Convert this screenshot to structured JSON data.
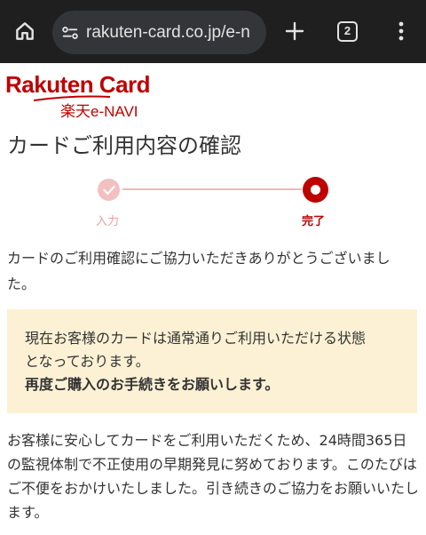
{
  "browser": {
    "url": "rakuten-card.co.jp/e-n",
    "tab_count": "2",
    "colors": {
      "bar": "#1f1f1f",
      "pill": "#333538",
      "icon": "#e3e3e3"
    },
    "icons": [
      "home-icon",
      "site-info-icon",
      "plus-icon",
      "tab-switcher-icon",
      "more-vert-icon"
    ]
  },
  "logo": {
    "main": "Rakuten Card",
    "sub": "楽天e-NAVI",
    "color": "#bf0000"
  },
  "page": {
    "title": "カードご利用内容の確認",
    "steps": [
      {
        "label": "入力",
        "state": "done"
      },
      {
        "label": "完了",
        "state": "current"
      }
    ],
    "thanks_text": "カードのご利用確認にご協力いただきありがとうございました。",
    "notice": {
      "line1": "現在お客様のカードは通常通りご利用いただける状態",
      "line2": "となっております。",
      "line3": "再度ご購入のお手続きをお願いします。"
    },
    "security_text": "お客様に安心してカードをご利用いただくため、24時間365日の監視体制で不正使用の早期発見に努めております。このたびはご不便をおかけいたしました。引き続きのご協力をお願いいたします。"
  }
}
